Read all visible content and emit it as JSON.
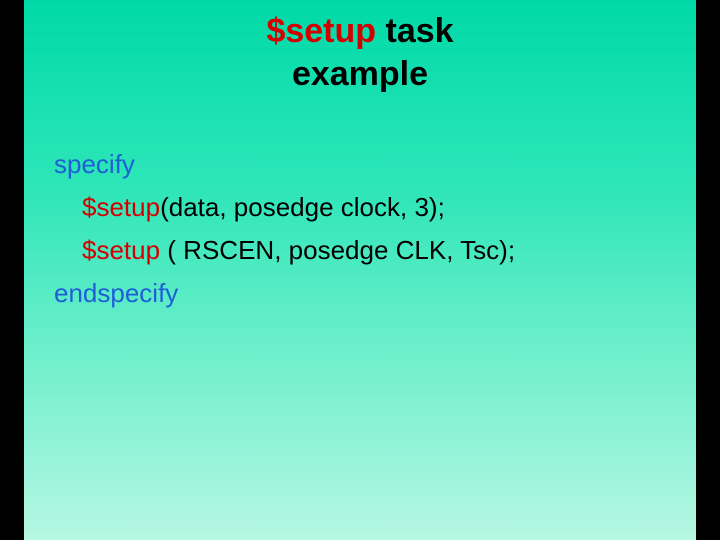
{
  "title": {
    "setup": "$setup",
    "rest": " task",
    "line2": "example"
  },
  "code": {
    "l1": {
      "specify": "specify"
    },
    "l2": {
      "setup": "$setup",
      "rest": "(data, posedge clock, 3);"
    },
    "l3": {
      "setup": "$setup",
      "rest": " ( RSCEN, posedge CLK, Tsc);"
    },
    "l4": {
      "endspecify": "endspecify"
    }
  }
}
